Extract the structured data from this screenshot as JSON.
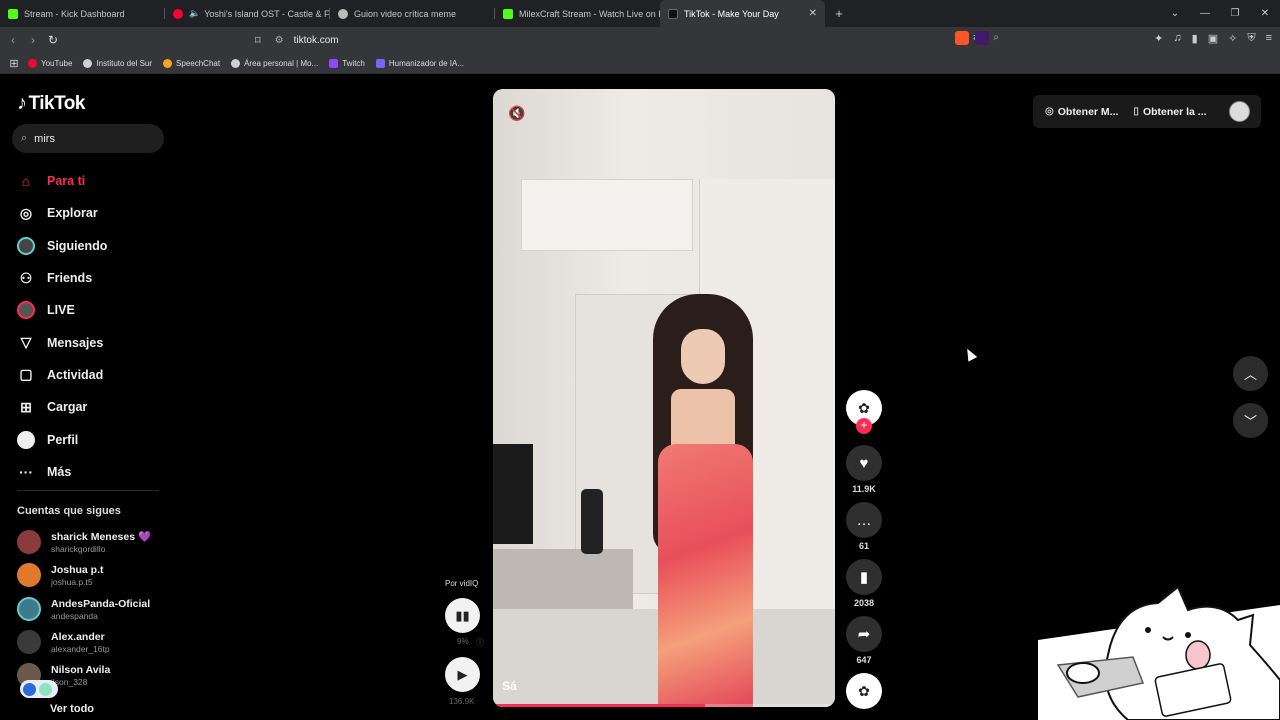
{
  "browser": {
    "tabs": [
      {
        "title": "Stream - Kick Dashboard",
        "color": "#53fc18"
      },
      {
        "title": "Yoshi's Island OST - Castle & Fort",
        "color": "#ff0033"
      },
      {
        "title": "Guion video crítica meme",
        "color": "#bbbbbb"
      },
      {
        "title": "MilexCraft Stream - Watch Live on Ki",
        "color": "#53fc18"
      },
      {
        "title": "TikTok - Make Your Day",
        "color": "#ffffff",
        "active": true
      }
    ],
    "url": "tiktok.com",
    "bookmarks": [
      {
        "label": "YouTube",
        "color": "#ff0033"
      },
      {
        "label": "Instituto del Sur",
        "color": "#cfcfcf"
      },
      {
        "label": "SpeechChat",
        "color": "#f5a623"
      },
      {
        "label": "Área personal | Mo...",
        "color": "#cfcfcf"
      },
      {
        "label": "Twitch",
        "color": "#9146ff"
      },
      {
        "label": "Humanizador de IA...",
        "color": "#7b61ff"
      }
    ]
  },
  "sidebar": {
    "logo": "TikTok",
    "search_value": "mirs",
    "nav": [
      {
        "label": "Para ti",
        "icon": "home-icon",
        "active": true
      },
      {
        "label": "Explorar",
        "icon": "compass-icon"
      },
      {
        "label": "Siguiendo",
        "icon": "following-avatar-icon"
      },
      {
        "label": "Friends",
        "icon": "friends-icon"
      },
      {
        "label": "LIVE",
        "icon": "live-icon"
      },
      {
        "label": "Mensajes",
        "icon": "send-icon"
      },
      {
        "label": "Actividad",
        "icon": "inbox-icon"
      },
      {
        "label": "Cargar",
        "icon": "upload-icon"
      },
      {
        "label": "Perfil",
        "icon": "profile-icon"
      },
      {
        "label": "Más",
        "icon": "more-icon"
      }
    ],
    "following_title": "Cuentas que sigues",
    "accounts": [
      {
        "name": "sharick Meneses 💜",
        "handle": "sharickgordillo",
        "color": "#8a3b3b"
      },
      {
        "name": "Joshua p.t",
        "handle": "joshua.p.t5",
        "color": "#e07a2a"
      },
      {
        "name": "AndesPanda-Oficial",
        "handle": "andespanda",
        "color": "#3d7a8c"
      },
      {
        "name": "Alex.ander",
        "handle": "alexander_16tp",
        "color": "#3a3a3a"
      },
      {
        "name": "Nilson Avila",
        "handle": "ilson_328",
        "color": "#6b5a4a"
      }
    ],
    "see_all": "Ver todo"
  },
  "video": {
    "caption": "Sá",
    "progress": 0.62
  },
  "actions": {
    "likes": "11.9K",
    "comments": "61",
    "saves": "2038",
    "shares": "647"
  },
  "vidiq": {
    "label": "Por vidIQ",
    "percent": "9%",
    "views": "136.9K"
  },
  "topbar": {
    "get_app": "Obtener M...",
    "get_desktop": "Obtener la ..."
  }
}
